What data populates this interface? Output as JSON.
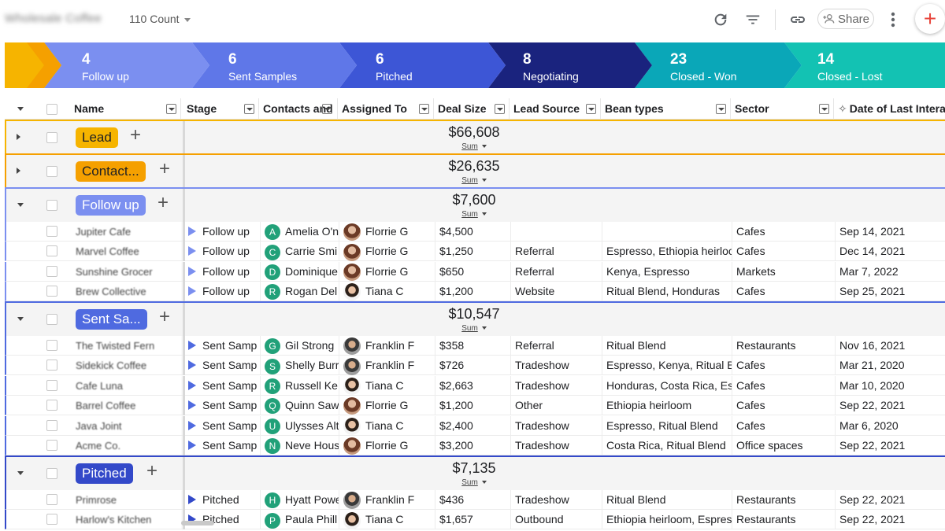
{
  "topbar": {
    "app_title": "Wholesale Coffee",
    "count_label": "110 Count",
    "share_label": "Share",
    "icons": [
      "refresh-icon",
      "filter-icon",
      "link-icon",
      "add-person-icon",
      "more-vert-icon",
      "plus-icon"
    ]
  },
  "pipeline": [
    {
      "count": "4",
      "label": "Follow up",
      "color": "#7b8ff0"
    },
    {
      "count": "6",
      "label": "Sent Samples",
      "color": "#5f77e8"
    },
    {
      "count": "6",
      "label": "Pitched",
      "color": "#3d56d6"
    },
    {
      "count": "8",
      "label": "Negotiating",
      "color": "#1a237e"
    },
    {
      "count": "23",
      "label": "Closed - Won",
      "color": "#0aa7b8"
    },
    {
      "count": "14",
      "label": "Closed - Lost",
      "color": "#10c2b3"
    }
  ],
  "columns": {
    "name": "Name",
    "stage": "Stage",
    "contacts": "Contacts and",
    "assigned": "Assigned To",
    "deal": "Deal Size",
    "lead_source": "Lead Source",
    "bean_types": "Bean types",
    "sector": "Sector",
    "date": "Date of Last Intera"
  },
  "groups": [
    {
      "label": "Lead",
      "sum": "$66,608",
      "sum_label": "Sum"
    },
    {
      "label": "Contact...",
      "sum": "$26,635",
      "sum_label": "Sum"
    },
    {
      "label": "Follow up",
      "sum": "$7,600",
      "sum_label": "Sum"
    },
    {
      "label": "Sent Sa...",
      "sum": "$10,547",
      "sum_label": "Sum"
    },
    {
      "label": "Pitched",
      "sum": "$7,135",
      "sum_label": "Sum"
    }
  ],
  "rows_follow_up": [
    {
      "name": "Jupiter Cafe",
      "stage": "Follow up",
      "contact_initial": "A",
      "contact": "Amelia O'n",
      "assigned": "Florrie G",
      "deal": "$4,500",
      "lead_source": "",
      "beans": "",
      "sector": "Cafes",
      "date": "Sep 14, 2021"
    },
    {
      "name": "Marvel Coffee",
      "stage": "Follow up",
      "contact_initial": "C",
      "contact": "Carrie Smi",
      "assigned": "Florrie G",
      "deal": "$1,250",
      "lead_source": "Referral",
      "beans": "Espresso, Ethiopia heirloo",
      "sector": "Cafes",
      "date": "Dec 14, 2021"
    },
    {
      "name": "Sunshine Grocer",
      "stage": "Follow up",
      "contact_initial": "D",
      "contact": "Dominique",
      "assigned": "Florrie G",
      "deal": "$650",
      "lead_source": "Referral",
      "beans": "Kenya, Espresso",
      "sector": "Markets",
      "date": "Mar 7, 2022"
    },
    {
      "name": "Brew Collective",
      "stage": "Follow up",
      "contact_initial": "R",
      "contact": "Rogan Del",
      "assigned": "Tiana C",
      "deal": "$1,200",
      "lead_source": "Website",
      "beans": "Ritual Blend, Honduras",
      "sector": "Cafes",
      "date": "Sep 25, 2021"
    }
  ],
  "rows_sent_samples": [
    {
      "name": "The Twisted Fern",
      "stage": "Sent Samp",
      "contact_initial": "G",
      "contact": "Gil Strong",
      "assigned": "Franklin F",
      "deal": "$358",
      "lead_source": "Referral",
      "beans": "Ritual Blend",
      "sector": "Restaurants",
      "date": "Nov 16, 2021"
    },
    {
      "name": "Sidekick Coffee",
      "stage": "Sent Samp",
      "contact_initial": "S",
      "contact": "Shelly Burr",
      "assigned": "Franklin F",
      "deal": "$726",
      "lead_source": "Tradeshow",
      "beans": "Espresso, Kenya, Ritual B",
      "sector": "Cafes",
      "date": "Mar 21, 2020"
    },
    {
      "name": "Cafe Luna",
      "stage": "Sent Samp",
      "contact_initial": "R",
      "contact": "Russell Ke",
      "assigned": "Tiana C",
      "deal": "$2,663",
      "lead_source": "Tradeshow",
      "beans": "Honduras, Costa Rica, Es",
      "sector": "Cafes",
      "date": "Mar 10, 2020"
    },
    {
      "name": "Barrel Coffee",
      "stage": "Sent Samp",
      "contact_initial": "Q",
      "contact": "Quinn Saw",
      "assigned": "Florrie G",
      "deal": "$1,200",
      "lead_source": "Other",
      "beans": "Ethiopia heirloom",
      "sector": "Cafes",
      "date": "Sep 22, 2021"
    },
    {
      "name": "Java Joint",
      "stage": "Sent Samp",
      "contact_initial": "U",
      "contact": "Ulysses Alt",
      "assigned": "Tiana C",
      "deal": "$2,400",
      "lead_source": "Tradeshow",
      "beans": "Espresso, Ritual Blend",
      "sector": "Cafes",
      "date": "Mar 6, 2020"
    },
    {
      "name": "Acme Co.",
      "stage": "Sent Samp",
      "contact_initial": "N",
      "contact": "Neve Hous",
      "assigned": "Florrie G",
      "deal": "$3,200",
      "lead_source": "Tradeshow",
      "beans": "Costa Rica, Ritual Blend",
      "sector": "Office spaces",
      "date": "Sep 22, 2021"
    }
  ],
  "rows_pitched": [
    {
      "name": "Primrose",
      "stage": "Pitched",
      "contact_initial": "H",
      "contact": "Hyatt Powe",
      "assigned": "Franklin F",
      "deal": "$436",
      "lead_source": "Tradeshow",
      "beans": "Ritual Blend",
      "sector": "Restaurants",
      "date": "Sep 22, 2021"
    },
    {
      "name": "Harlow's Kitchen",
      "stage": "Pitched",
      "contact_initial": "P",
      "contact": "Paula Phill",
      "assigned": "Tiana C",
      "deal": "$1,657",
      "lead_source": "Outbound",
      "beans": "Ethiopia heirloom, Espres",
      "sector": "Restaurants",
      "date": "Sep 22, 2021"
    }
  ],
  "colors": {
    "lead": "#f6b400",
    "contacted": "#f5a000",
    "follow_up": "#7b8ff0",
    "sent_samples": "#4f6ae0",
    "pitched": "#3349c9"
  }
}
